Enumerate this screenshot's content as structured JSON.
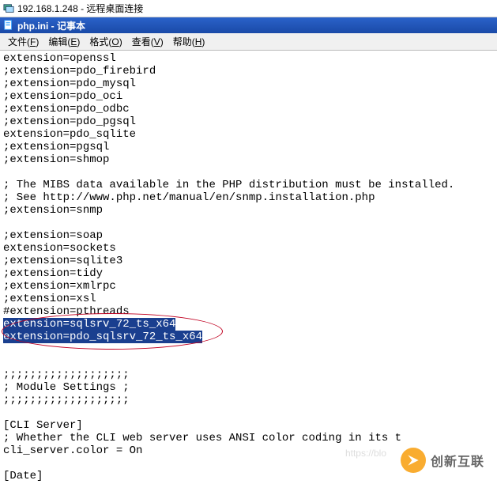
{
  "outer": {
    "title": "192.168.1.248 - 远程桌面连接"
  },
  "inner": {
    "title": "php.ini - 记事本"
  },
  "menu": {
    "file": "文件(F)",
    "edit": "编辑(E)",
    "format": "格式(O)",
    "view": "查看(V)",
    "help": "帮助(H)"
  },
  "lines": [
    "extension=openssl",
    ";extension=pdo_firebird",
    ";extension=pdo_mysql",
    ";extension=pdo_oci",
    ";extension=pdo_odbc",
    ";extension=pdo_pgsql",
    "extension=pdo_sqlite",
    ";extension=pgsql",
    ";extension=shmop",
    "",
    "; The MIBS data available in the PHP distribution must be installed.",
    "; See http://www.php.net/manual/en/snmp.installation.php",
    ";extension=snmp",
    "",
    ";extension=soap",
    "extension=sockets",
    ";extension=sqlite3",
    ";extension=tidy",
    ";extension=xmlrpc",
    ";extension=xsl",
    "#extension=pthreads"
  ],
  "selected": [
    "extension=sqlsrv_72_ts_x64",
    "extension=pdo_sqlsrv_72_ts_x64"
  ],
  "tail": [
    "",
    "",
    ";;;;;;;;;;;;;;;;;;;",
    "; Module Settings ;",
    ";;;;;;;;;;;;;;;;;;;",
    "",
    "[CLI Server]",
    "; Whether the CLI web server uses ANSI color coding in its t",
    "cli_server.color = On",
    "",
    "[Date]"
  ],
  "watermark": {
    "faint": "https://blo",
    "text": "创新互联"
  }
}
